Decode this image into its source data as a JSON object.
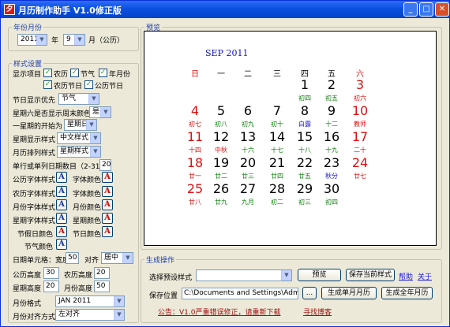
{
  "window": {
    "title": "月历制作助手 V1.0修正版",
    "min": "_",
    "max": "□",
    "close": "✕"
  },
  "year_month": {
    "legend": "年份月份",
    "year": "2011",
    "year_label": "年",
    "month": "9",
    "month_label": "月（公历）"
  },
  "style": {
    "legend": "样式设置",
    "display_items_label": "显示项目",
    "checks": [
      {
        "label": "农历",
        "checked": true
      },
      {
        "label": "节气",
        "checked": true
      },
      {
        "label": "年月份",
        "checked": true
      },
      {
        "label": "农历节日",
        "checked": true
      },
      {
        "label": "公历节日",
        "checked": true
      }
    ],
    "festival_priority_label": "节日显示优先",
    "festival_priority_value": "节气",
    "weekend_color_label": "星期六是否显示周末颜色",
    "weekend_color_value": "是",
    "week_start_label": "一星期的开始为",
    "week_start_value": "星期日",
    "week_style_label": "星期显示样式",
    "week_style_value": "中文样式",
    "month_layout_label": "月历排列样式",
    "month_layout_value": "星期样式",
    "single_days_label": "单行或单列日期数目（2-31）",
    "single_days_value": "20",
    "gregorian_font_label": "公历字体样式",
    "font_color_label_1": "字体颜色",
    "lunar_font_label": "农历字体样式",
    "font_color_label_2": "字体颜色",
    "month_font_label": "月份字体样式",
    "month_color_label": "月份颜色",
    "week_font_label": "星期字体样式",
    "week_color_label": "星期颜色",
    "festival_color_label": "节假日颜色",
    "lunar_day_color_label": "节日颜色",
    "solar_term_color_label": "节气颜色",
    "date_cell_label": "日期单元格：宽度",
    "date_cell_width": "50",
    "align_label": "对齐",
    "align_value": "居中",
    "gregorian_height_label": "公历高度",
    "gregorian_height_value": "30",
    "lunar_height_label": "农历高度",
    "lunar_height_value": "20",
    "week_height_label": "星期高度",
    "week_height_value": "20",
    "month_height_label": "月份高度",
    "month_height_value": "50",
    "month_format_label": "月份格式",
    "month_format_value": "JAN 2011",
    "month_align_label": "月份对齐方式",
    "month_align_value": "左对齐",
    "font_button_glyph": "A"
  },
  "preview": {
    "legend": "预览",
    "month_title": "SEP 2011",
    "weekdays": [
      "日",
      "一",
      "二",
      "三",
      "四",
      "五",
      "六"
    ],
    "rows": [
      [
        null,
        null,
        null,
        null,
        {
          "d": "1",
          "l": "初四"
        },
        {
          "d": "2",
          "l": "初五"
        },
        {
          "d": "3",
          "l": "初六"
        }
      ],
      [
        {
          "d": "4",
          "l": "初七"
        },
        {
          "d": "5",
          "l": "初八"
        },
        {
          "d": "6",
          "l": "初九"
        },
        {
          "d": "7",
          "l": "初十"
        },
        {
          "d": "8",
          "l": "白露"
        },
        {
          "d": "9",
          "l": "十二"
        },
        {
          "d": "10",
          "l": "教师"
        }
      ],
      [
        {
          "d": "11",
          "l": "十四"
        },
        {
          "d": "12",
          "l": "中秋"
        },
        {
          "d": "13",
          "l": "十六"
        },
        {
          "d": "14",
          "l": "十七"
        },
        {
          "d": "15",
          "l": "十八"
        },
        {
          "d": "16",
          "l": "十九"
        },
        {
          "d": "17",
          "l": "二十"
        }
      ],
      [
        {
          "d": "18",
          "l": "廿一"
        },
        {
          "d": "19",
          "l": "廿二"
        },
        {
          "d": "20",
          "l": "廿三"
        },
        {
          "d": "21",
          "l": "廿四"
        },
        {
          "d": "22",
          "l": "廿五"
        },
        {
          "d": "23",
          "l": "秋分"
        },
        {
          "d": "24",
          "l": "廿七"
        }
      ],
      [
        {
          "d": "25",
          "l": "廿八"
        },
        {
          "d": "26",
          "l": "廿九"
        },
        {
          "d": "27",
          "l": "九月"
        },
        {
          "d": "28",
          "l": "初二"
        },
        {
          "d": "29",
          "l": "初三"
        },
        {
          "d": "30",
          "l": "初四"
        },
        null
      ]
    ],
    "colors": {
      "month": "#1010d0",
      "weekday": "#000000",
      "weekend": "#e01010",
      "date": "#000000",
      "lunar": "#108010",
      "festival": "#e01010",
      "term": "#1010d0"
    }
  },
  "generate": {
    "legend": "生成操作",
    "preset_label": "选择预设样式",
    "preset_value": "",
    "preview_button": "预览",
    "save_style_button": "保存当前样式",
    "help_link": "帮助",
    "about_link": "关于",
    "save_location_label": "保存位置",
    "save_location_value": "C:\\Documents and Settings\\Administ",
    "browse_button": "...",
    "single_month_button": "生成单月月历",
    "full_year_button": "生成全年月历",
    "notice": "公告：V1.0严重错误修正，请重新下载",
    "blog_link": "寻找博客"
  }
}
